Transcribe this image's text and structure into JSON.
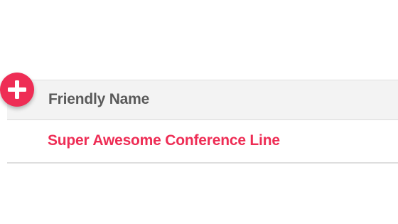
{
  "table": {
    "columns": [
      {
        "label": "Friendly Name"
      }
    ],
    "rows": [
      {
        "friendly_name": "Super Awesome Conference Line"
      }
    ]
  },
  "add_button": {
    "icon": "plus-icon",
    "color": "#ee2d55"
  },
  "colors": {
    "accent": "#ee2d55",
    "header_bg": "#f3f3f3",
    "header_text": "#5a5a5a",
    "divider": "#dedede"
  }
}
